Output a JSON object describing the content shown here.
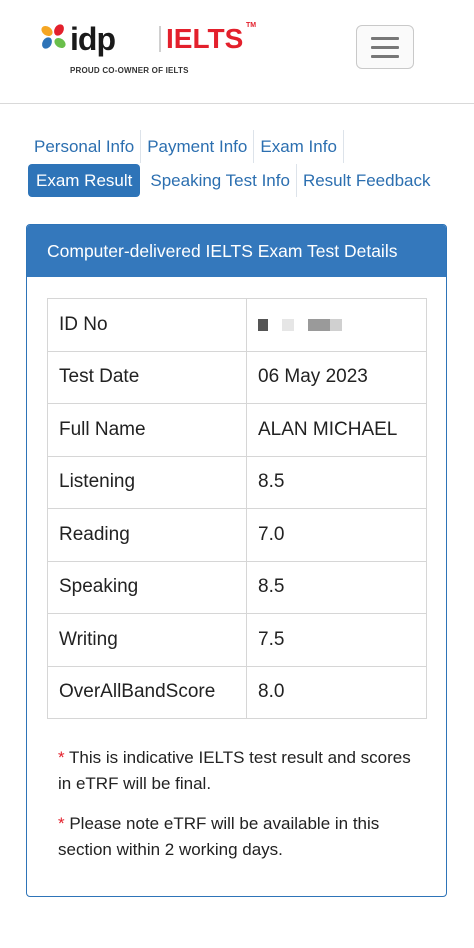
{
  "header": {
    "logo_idp": "idp",
    "logo_ielts": "IELTS",
    "logo_tm": "TM",
    "tagline": "PROUD CO-OWNER OF IELTS"
  },
  "tabs": {
    "row1": [
      "Personal Info",
      "Payment Info",
      "Exam Info"
    ],
    "row2": [
      "Exam Result",
      "Speaking Test Info",
      "Result Feedback"
    ],
    "active": "Exam Result"
  },
  "card": {
    "title": "Computer-delivered IELTS Exam Test Details",
    "rows": [
      {
        "label": "ID No",
        "value": ""
      },
      {
        "label": "Test Date",
        "value": "06 May 2023"
      },
      {
        "label": "Full Name",
        "value": "ALAN MICHAEL"
      },
      {
        "label": "Listening",
        "value": "8.5"
      },
      {
        "label": "Reading",
        "value": "7.0"
      },
      {
        "label": "Speaking",
        "value": "8.5"
      },
      {
        "label": "Writing",
        "value": "7.5"
      },
      {
        "label": "OverAllBandScore",
        "value": "8.0"
      }
    ],
    "notes": [
      {
        "marker": "*",
        "text": " This is indicative IELTS test result and scores in eTRF will be final."
      },
      {
        "marker": "*",
        "text": " Please note eTRF will be available in this section within 2 working days."
      }
    ]
  },
  "colors": {
    "primary": "#3478bc",
    "link": "#2c6fb0",
    "brand_red": "#e3202c"
  },
  "icons": {
    "menu": "hamburger-icon",
    "logo": "idp-logo-mark"
  }
}
